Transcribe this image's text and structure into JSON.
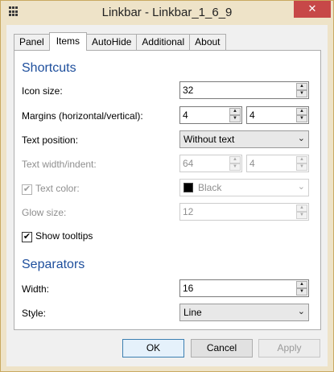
{
  "window": {
    "title": "Linkbar - Linkbar_1_6_9",
    "close_glyph": "✕"
  },
  "tabs": [
    {
      "label": "Panel",
      "active": false
    },
    {
      "label": "Items",
      "active": true
    },
    {
      "label": "AutoHide",
      "active": false
    },
    {
      "label": "Additional",
      "active": false
    },
    {
      "label": "About",
      "active": false
    }
  ],
  "shortcuts": {
    "heading": "Shortcuts",
    "icon_size": {
      "label": "Icon size:",
      "value": "32"
    },
    "margins": {
      "label": "Margins (horizontal/vertical):",
      "h": "4",
      "v": "4"
    },
    "text_position": {
      "label": "Text position:",
      "value": "Without text"
    },
    "text_width": {
      "label": "Text width/indent:",
      "width": "64",
      "indent": "4",
      "disabled": true
    },
    "text_color": {
      "label": "Text color:",
      "value": "Black",
      "checked": true,
      "disabled": true
    },
    "glow_size": {
      "label": "Glow size:",
      "value": "12",
      "disabled": true
    },
    "show_tooltips": {
      "label": "Show tooltips",
      "checked": true
    }
  },
  "separators": {
    "heading": "Separators",
    "width": {
      "label": "Width:",
      "value": "16"
    },
    "style": {
      "label": "Style:",
      "value": "Line"
    }
  },
  "buttons": {
    "ok": "OK",
    "cancel": "Cancel",
    "apply": "Apply"
  },
  "glyphs": {
    "check": "✔",
    "up": "▲",
    "down": "▼",
    "chevron": "⌄"
  },
  "colors": {
    "accent": "#1d4e9c",
    "frame": "#eee3c8",
    "close": "#c74848",
    "swatch": "#000000"
  }
}
